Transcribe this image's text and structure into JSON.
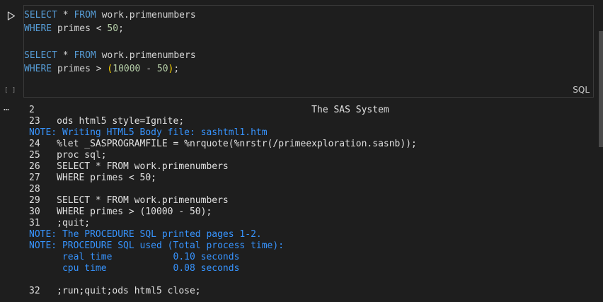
{
  "gutter": {
    "run_icon": "play-icon",
    "exec_status": "[ ]",
    "more_icon": "ellipsis-icon",
    "more_glyph": "…"
  },
  "cell": {
    "language": "SQL",
    "lines": [
      [
        {
          "t": "SELECT",
          "c": "kw"
        },
        {
          "t": " * "
        },
        {
          "t": "FROM",
          "c": "kw"
        },
        {
          "t": " work.primenumbers"
        }
      ],
      [
        {
          "t": "WHERE",
          "c": "kw"
        },
        {
          "t": " primes < "
        },
        {
          "t": "50",
          "c": "num"
        },
        {
          "t": ";"
        }
      ],
      [],
      [
        {
          "t": "SELECT",
          "c": "kw"
        },
        {
          "t": " * "
        },
        {
          "t": "FROM",
          "c": "kw"
        },
        {
          "t": " work.primenumbers"
        }
      ],
      [
        {
          "t": "WHERE",
          "c": "kw"
        },
        {
          "t": " primes > "
        },
        {
          "t": "(",
          "c": "paren"
        },
        {
          "t": "10000",
          "c": "num"
        },
        {
          "t": " - "
        },
        {
          "t": "50",
          "c": "num"
        },
        {
          "t": ")",
          "c": "paren"
        },
        {
          "t": ";"
        }
      ]
    ]
  },
  "output": {
    "lines": [
      {
        "text": "2                                                  The SAS System",
        "type": "log"
      },
      {
        "text": "23   ods html5 style=Ignite;",
        "type": "log"
      },
      {
        "text": "NOTE: Writing HTML5 Body file: sashtml1.htm",
        "type": "note"
      },
      {
        "text": "24   %let _SASPROGRAMFILE = %nrquote(%nrstr(/primeexploration.sasnb));",
        "type": "log"
      },
      {
        "text": "25   proc sql;",
        "type": "log"
      },
      {
        "text": "26   SELECT * FROM work.primenumbers",
        "type": "log"
      },
      {
        "text": "27   WHERE primes < 50;",
        "type": "log"
      },
      {
        "text": "28",
        "type": "log"
      },
      {
        "text": "29   SELECT * FROM work.primenumbers",
        "type": "log"
      },
      {
        "text": "30   WHERE primes > (10000 - 50);",
        "type": "log"
      },
      {
        "text": "31   ;quit;",
        "type": "log"
      },
      {
        "text": "NOTE: The PROCEDURE SQL printed pages 1-2.",
        "type": "note"
      },
      {
        "text": "NOTE: PROCEDURE SQL used (Total process time):",
        "type": "note"
      },
      {
        "text": "      real time           0.10 seconds",
        "type": "note"
      },
      {
        "text": "      cpu time            0.08 seconds",
        "type": "note"
      },
      {
        "text": "",
        "type": "log"
      },
      {
        "text": "32   ;run;quit;ods html5 close;",
        "type": "log"
      }
    ]
  },
  "colors": {
    "background": "#1e1e1e",
    "keyword": "#569cd6",
    "number": "#b5cea8",
    "note": "#3794ff",
    "text": "#d4d4d4"
  }
}
